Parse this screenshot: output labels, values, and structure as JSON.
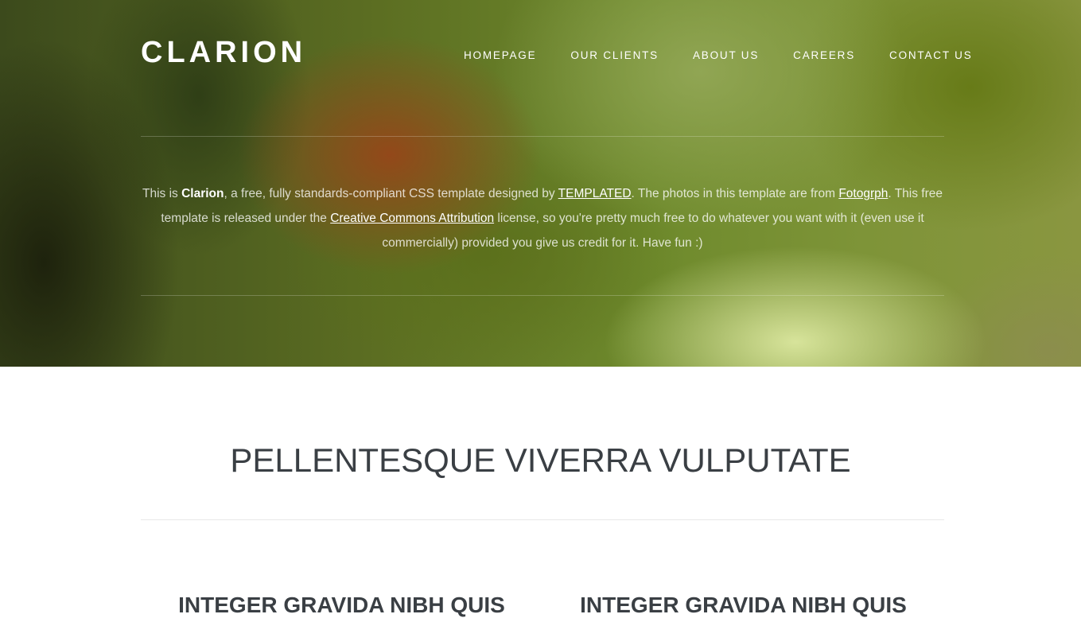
{
  "site": {
    "logo": "CLARION"
  },
  "nav": {
    "items": [
      {
        "label": "HOMEPAGE"
      },
      {
        "label": "OUR CLIENTS"
      },
      {
        "label": "ABOUT US"
      },
      {
        "label": "CAREERS"
      },
      {
        "label": "CONTACT US"
      }
    ]
  },
  "intro": {
    "t1": "This is ",
    "brand": "Clarion",
    "t2": ", a free, fully standards-compliant CSS template designed by ",
    "link_templated": "TEMPLATED",
    "t3": ". The photos in this template are from ",
    "link_fotogrph": "Fotogrph",
    "t4": ". This free template is released under the ",
    "link_cc": "Creative Commons Attribution",
    "t5": " license, so you're pretty much free to do whatever you want with it (even use it commercially) provided you give us credit for it. Have fun :)"
  },
  "main": {
    "title": "PELLENTESQUE VIVERRA VULPUTATE",
    "columns": [
      {
        "title": "INTEGER GRAVIDA NIBH QUIS"
      },
      {
        "title": "INTEGER GRAVIDA NIBH QUIS"
      }
    ]
  },
  "colors": {
    "title_text": "#3a3f44",
    "hero_text": "#ffffff",
    "divider": "#e8e8e8"
  }
}
